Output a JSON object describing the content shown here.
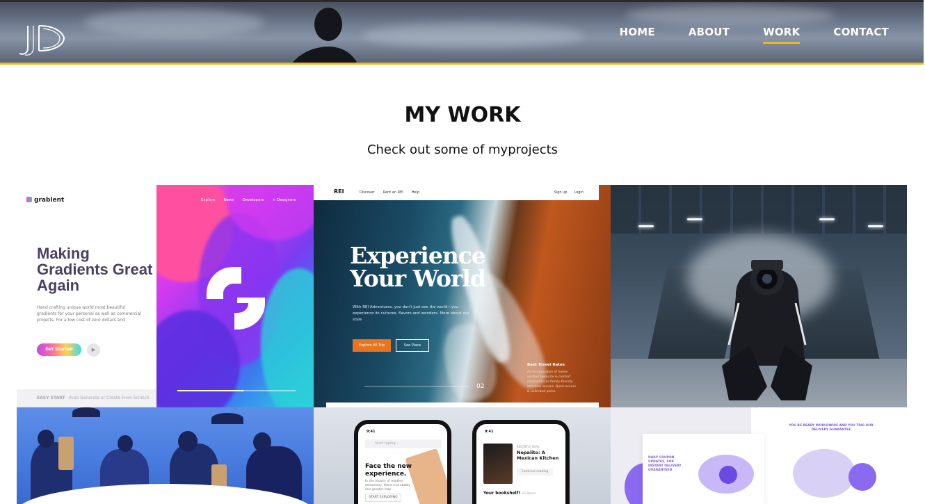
{
  "nav": {
    "items": [
      {
        "label": "HOME",
        "active": false
      },
      {
        "label": "ABOUT",
        "active": false
      },
      {
        "label": "WORK",
        "active": true
      },
      {
        "label": "CONTACT",
        "active": false
      }
    ]
  },
  "page": {
    "title": "MY WORK",
    "subtitle": "Check out some of myprojects"
  },
  "colors": {
    "accent": "#f0b622"
  },
  "projects": {
    "grablent": {
      "brand": "grablent",
      "headline": "Making Gradients Great Again",
      "description": "Hand crafting unique world most beautiful gradients for your personal as well as commercial projects. For a low cost of zero dollars and",
      "cta": "Get Started",
      "footer": "EASY START",
      "footer_note": "Auto Generate or Create From Scratch",
      "topnav": [
        "Explore",
        "News",
        "Developers",
        "+ Designers"
      ]
    },
    "rei": {
      "brand": "REI",
      "menu": [
        "Discover",
        "Rent an REI",
        "Help"
      ],
      "menu_right": [
        "Sign up",
        "Login"
      ],
      "headline": "Experience Your World",
      "lead": "With REI Adventures, you don't just see the world—you experience its cultures, flavors and wonders. More about our style",
      "btn_explore": "Explore All Trip",
      "btn_see": "See Place",
      "rates_title": "Best Travel Rates",
      "rates_text": "An incorporation of home-verified favourite & comfort destination as family-friendly activities service. Quick access & unlimited perks.",
      "counter": "02"
    },
    "reading_app": {
      "time": "9:41",
      "search_placeholder": "Start typing...",
      "headline": "Face the new experience.",
      "subtext": "In the history of modern astronomy, there is probably one greater leap",
      "start": "START EXPLORING",
      "recent": "RECENTLY READ",
      "book": "Nopalito: A Mexican Kitchen",
      "continue": "Continue reading",
      "shelf": "Your bookshelf!",
      "shelf_count": "23 Books"
    },
    "delivery": {
      "tagline": "DAILY COUPON UPDATES, FOR INSTANT DELIVERY GUARANTEED",
      "tagline_right": "YOU BE READY WORLDWIDE AND YOU TRIG OUR DELIVERY GUARANTEE"
    }
  }
}
